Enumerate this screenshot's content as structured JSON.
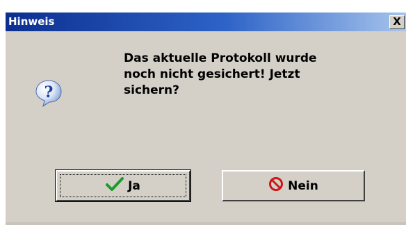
{
  "window": {
    "title": "Hinweis",
    "close_label": "X"
  },
  "dialog": {
    "icon": "question-icon",
    "message": "Das aktuelle Protokoll wurde\nnoch nicht gesichert! Jetzt\nsichern?"
  },
  "buttons": {
    "yes_label": "Ja",
    "no_label": "Nein"
  },
  "colors": {
    "titlebar_start": "#0b2f8f",
    "titlebar_end": "#a6c4ec",
    "dialog_bg": "#d4d0c8",
    "check_green": "#1e9a2a",
    "no_red": "#d01616"
  }
}
